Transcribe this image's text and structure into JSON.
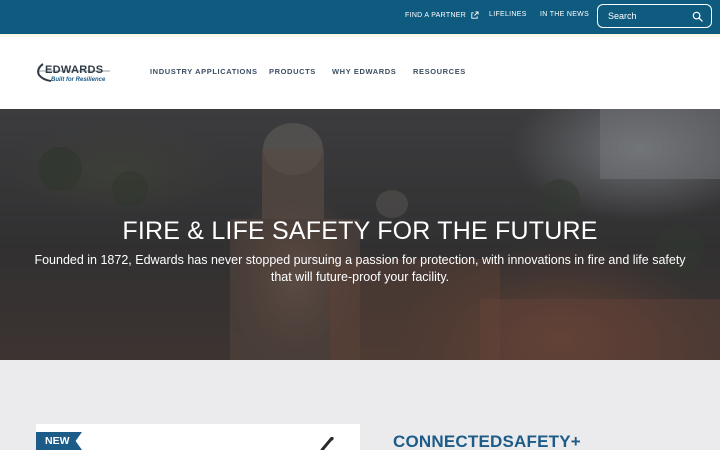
{
  "topbar": {
    "find_partner": "FIND A PARTNER",
    "lifelines": "LIFELINES",
    "in_the_news": "IN THE NEWS",
    "search_placeholder": "Search",
    "bg_color": "#0f5a7f"
  },
  "logo": {
    "wordmark": "EDWARDS",
    "tagline": "Built for Resilience"
  },
  "nav": {
    "industry_applications": "INDUSTRY APPLICATIONS",
    "products": "PRODUCTS",
    "why_edwards": "WHY EDWARDS",
    "resources": "RESOURCES"
  },
  "hero": {
    "title": "FIRE & LIFE SAFETY FOR THE FUTURE",
    "subtitle": "Founded in 1872, Edwards has never stopped pursuing a passion for protection, with innovations in fire and life safety that will future-proof your facility."
  },
  "feature": {
    "badge": "NEW",
    "title": "CONNECTEDSAFETY+"
  },
  "colors": {
    "brand_blue": "#1d5b88",
    "nav_text": "#3b4f63",
    "section_bg": "#ebebee"
  },
  "icons": {
    "external": "external-link-icon",
    "search": "search-icon"
  }
}
